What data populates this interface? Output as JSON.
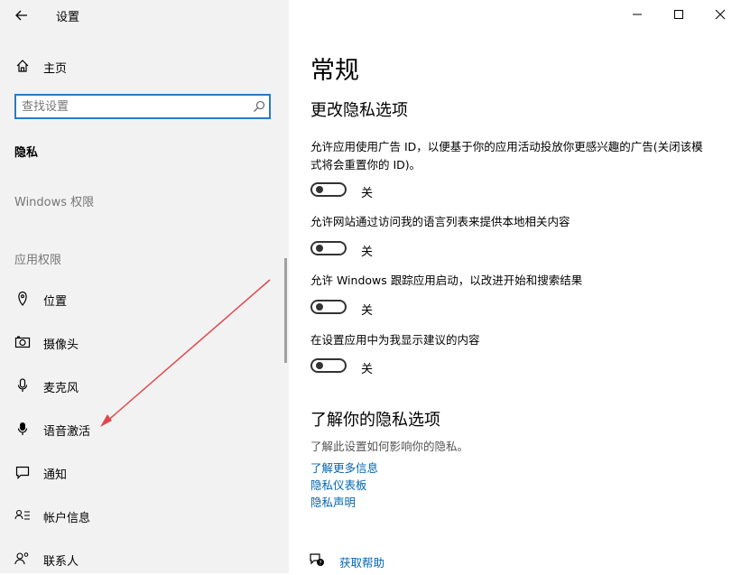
{
  "window": {
    "title": "设置",
    "minimize_icon": "minimize-icon",
    "maximize_icon": "maximize-icon",
    "close_icon": "close-icon"
  },
  "sidebar": {
    "home": {
      "label": "主页",
      "icon": "home-icon"
    },
    "search": {
      "value": "",
      "placeholder": "查找设置",
      "icon": "search-icon"
    },
    "category_label": "隐私",
    "windows_permissions_label": "Windows 权限",
    "app_permissions_label": "应用权限",
    "items": [
      {
        "label": "位置",
        "icon": "location-icon"
      },
      {
        "label": "摄像头",
        "icon": "camera-icon"
      },
      {
        "label": "麦克风",
        "icon": "microphone-icon"
      },
      {
        "label": "语音激活",
        "icon": "voice-activation-icon"
      },
      {
        "label": "通知",
        "icon": "notification-icon"
      },
      {
        "label": "帐户信息",
        "icon": "account-info-icon"
      },
      {
        "label": "联系人",
        "icon": "contacts-icon"
      }
    ]
  },
  "main": {
    "page_title": "常规",
    "section_title": "更改隐私选项",
    "settings": [
      {
        "description": "允许应用使用广告 ID，以便基于你的应用活动投放你更感兴趣的广告(关闭该模式将会重置你的 ID)。",
        "state": "关",
        "on": false
      },
      {
        "description": "允许网站通过访问我的语言列表来提供本地相关内容",
        "state": "关",
        "on": false
      },
      {
        "description": "允许 Windows 跟踪应用启动，以改进开始和搜索结果",
        "state": "关",
        "on": false
      },
      {
        "description": "在设置应用中为我显示建议的内容",
        "state": "关",
        "on": false
      }
    ],
    "learn_title": "了解你的隐私选项",
    "learn_desc": "了解此设置如何影响你的隐私。",
    "links": [
      "了解更多信息",
      "隐私仪表板",
      "隐私声明"
    ],
    "help": {
      "label": "获取帮助",
      "icon": "help-chat-icon"
    }
  },
  "colors": {
    "sidebar_bg": "#f2f2f2",
    "accent": "#0066b4",
    "search_border": "#2b79c2",
    "annotation_arrow": "#e0474c"
  }
}
